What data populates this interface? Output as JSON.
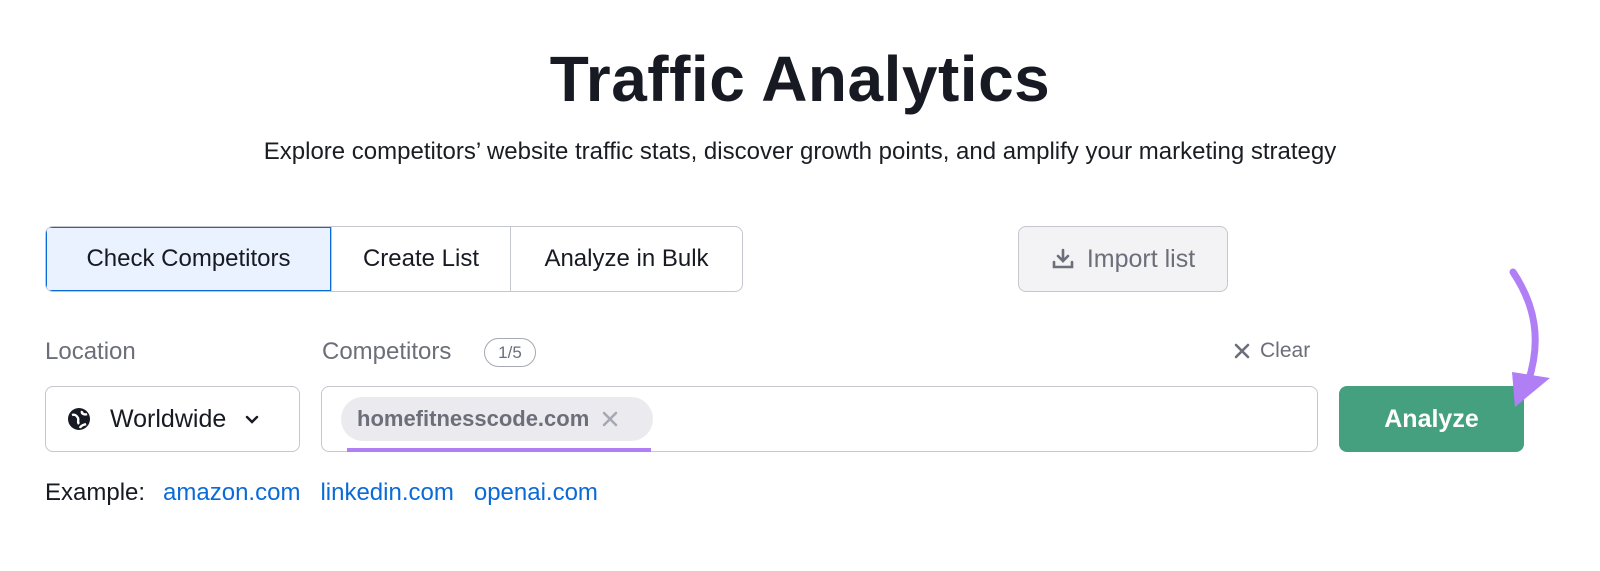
{
  "header": {
    "title": "Traffic Analytics",
    "subtitle": "Explore competitors’ website traffic stats, discover growth points, and amplify your marketing strategy"
  },
  "tabs": [
    {
      "label": "Check Competitors",
      "active": true
    },
    {
      "label": "Create List",
      "active": false
    },
    {
      "label": "Analyze in Bulk",
      "active": false
    }
  ],
  "import_button": {
    "label": "Import list",
    "icon": "download-icon"
  },
  "location": {
    "label": "Location",
    "value": "Worldwide",
    "icon": "globe-icon"
  },
  "competitors": {
    "label": "Competitors",
    "count": "1/5",
    "chips": [
      "homefitnesscode.com"
    ]
  },
  "clear_label": "Clear",
  "analyze_label": "Analyze",
  "example": {
    "label": "Example:",
    "links": [
      "amazon.com",
      "linkedin.com",
      "openai.com"
    ]
  },
  "colors": {
    "accent": "#45a080",
    "annotation": "#b07ef5",
    "link": "#0a6ad8",
    "active_tab": "#e9f2fe"
  }
}
